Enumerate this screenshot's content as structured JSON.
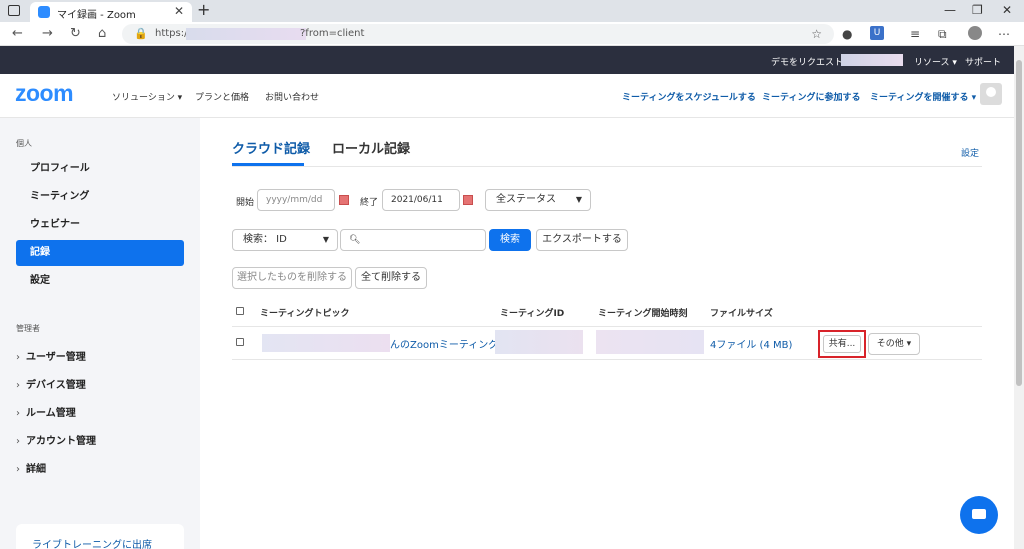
{
  "browser": {
    "tab_title": "マイ録画 - Zoom",
    "tab_close": "✕",
    "new_tab": "+",
    "url_prefix": "https://",
    "url_suffix": "?from=client",
    "window_controls": [
      "—",
      "❐",
      "✕"
    ]
  },
  "topbar": {
    "request_demo": "デモをリクエスト",
    "resources": "リソース ▾",
    "support": "サポート"
  },
  "header": {
    "logo": "zoom",
    "nav": [
      "ソリューション ▾",
      "プランと価格",
      "お問い合わせ"
    ],
    "actions": [
      "ミーティングをスケジュールする",
      "ミーティングに参加する",
      "ミーティングを開催する ▾"
    ]
  },
  "sidebar": {
    "personal_label": "個人",
    "items": [
      {
        "label": "プロフィール",
        "active": false
      },
      {
        "label": "ミーティング",
        "active": false
      },
      {
        "label": "ウェビナー",
        "active": false
      },
      {
        "label": "記録",
        "active": true
      },
      {
        "label": "設定",
        "active": false
      }
    ],
    "admin_label": "管理者",
    "admin_items": [
      "ユーザー管理",
      "デバイス管理",
      "ルーム管理",
      "アカウント管理",
      "詳細"
    ],
    "training": "ライブトレーニングに出席"
  },
  "main": {
    "tabs": [
      "クラウド記録",
      "ローカル記録"
    ],
    "settings_link": "設定",
    "filters": {
      "start_label": "開始",
      "start_placeholder": "yyyy/mm/dd",
      "end_label": "終了",
      "end_value": "2021/06/11",
      "status_select": "全ステータス",
      "search_type": "検索： ID",
      "search_button": "検索",
      "export_button": "エクスポートする",
      "delete_selected": "選択したものを削除する",
      "delete_all": "全て削除する"
    },
    "table": {
      "columns": [
        "ミーティングトピック",
        "ミーティングID",
        "ミーティング開始時刻",
        "ファイルサイズ"
      ],
      "rows": [
        {
          "topic": "んのZoomミーティング",
          "files": "4ファイル (4 MB)",
          "share": "共有...",
          "more": "その他 ▾"
        }
      ]
    }
  },
  "colors": {
    "brand": "#2d8cff",
    "primary": "#0e72ed",
    "link": "#0e5ba8",
    "highlight": "#d8232a"
  }
}
